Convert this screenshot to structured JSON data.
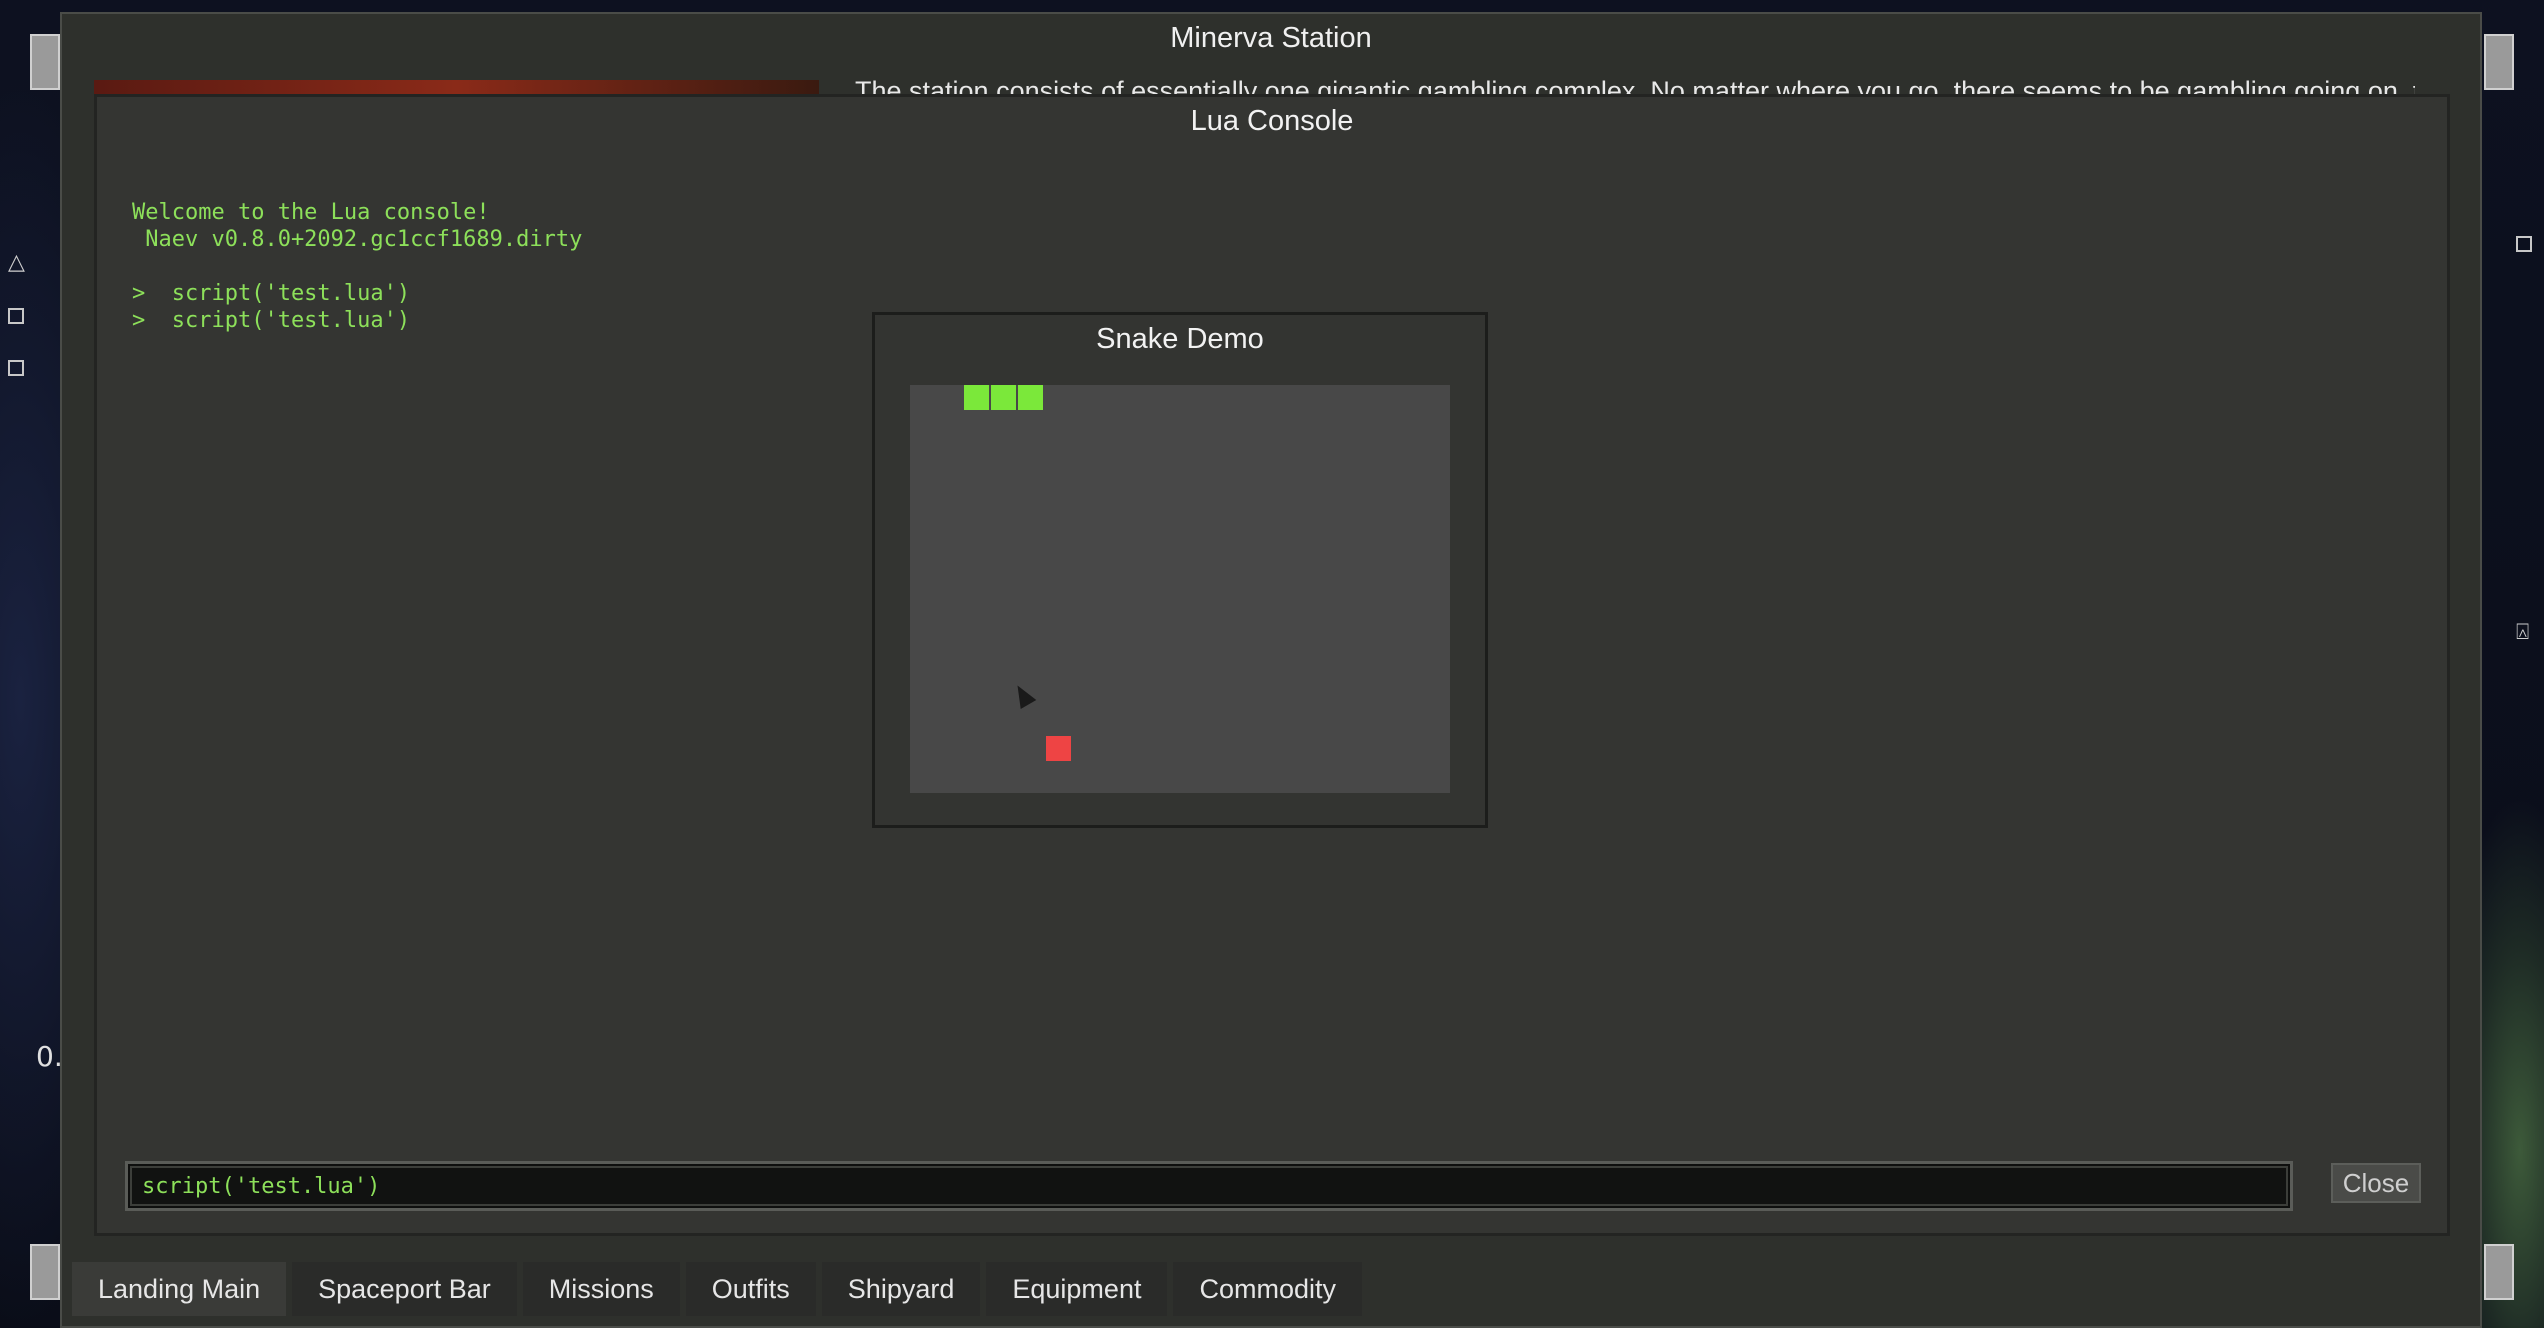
{
  "station": {
    "title": "Minerva Station",
    "description": "The station consists of essentially one gigantic gambling complex. No matter where you go, there seems to be gambling going on, that"
  },
  "console": {
    "title": "Lua Console",
    "log": "Welcome to the Lua console!\n Naev v0.8.0+2092.gc1ccf1689.dirty\n\n>  script('test.lua')\n>  script('test.lua')",
    "input_value": "script('test.lua')",
    "close_label": "Close"
  },
  "snake": {
    "title": "Snake Demo",
    "snake_color": "#7be83a",
    "food_color": "#ee4444"
  },
  "tabs": [
    {
      "label": "Landing Main"
    },
    {
      "label": "Spaceport Bar"
    },
    {
      "label": "Missions"
    },
    {
      "label": "Outfits"
    },
    {
      "label": "Shipyard"
    },
    {
      "label": "Equipment"
    },
    {
      "label": "Commodity"
    }
  ],
  "left_edge_text": "0."
}
